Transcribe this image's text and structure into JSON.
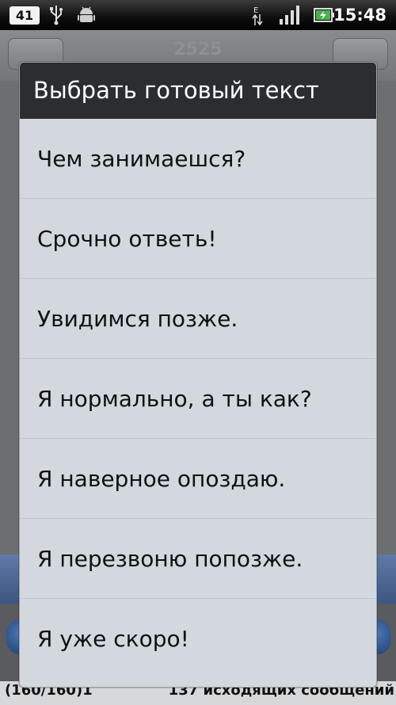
{
  "status_bar": {
    "notification_count": "41",
    "icons": [
      "usb-icon",
      "android-debug-icon",
      "data-e-icon",
      "signal-icon",
      "battery-charging-icon"
    ],
    "time": "15:48"
  },
  "app": {
    "title": "2525",
    "counter_left": "(160/160)1",
    "counter_right": "137 исходящих сообщений"
  },
  "dialog": {
    "title": "Выбрать готовый текст",
    "items": [
      "Чем занимаешся?",
      "Срочно ответь!",
      "Увидимся позже.",
      "Я нормально, а ты как?",
      "Я наверное опоздаю.",
      "Я перезвоню попозже.",
      "Я уже скоро!"
    ]
  },
  "colors": {
    "dialog_title_bg": "#2b2d31",
    "dialog_body_bg": "#d3d8de",
    "status_bar_bg": "#000000"
  }
}
